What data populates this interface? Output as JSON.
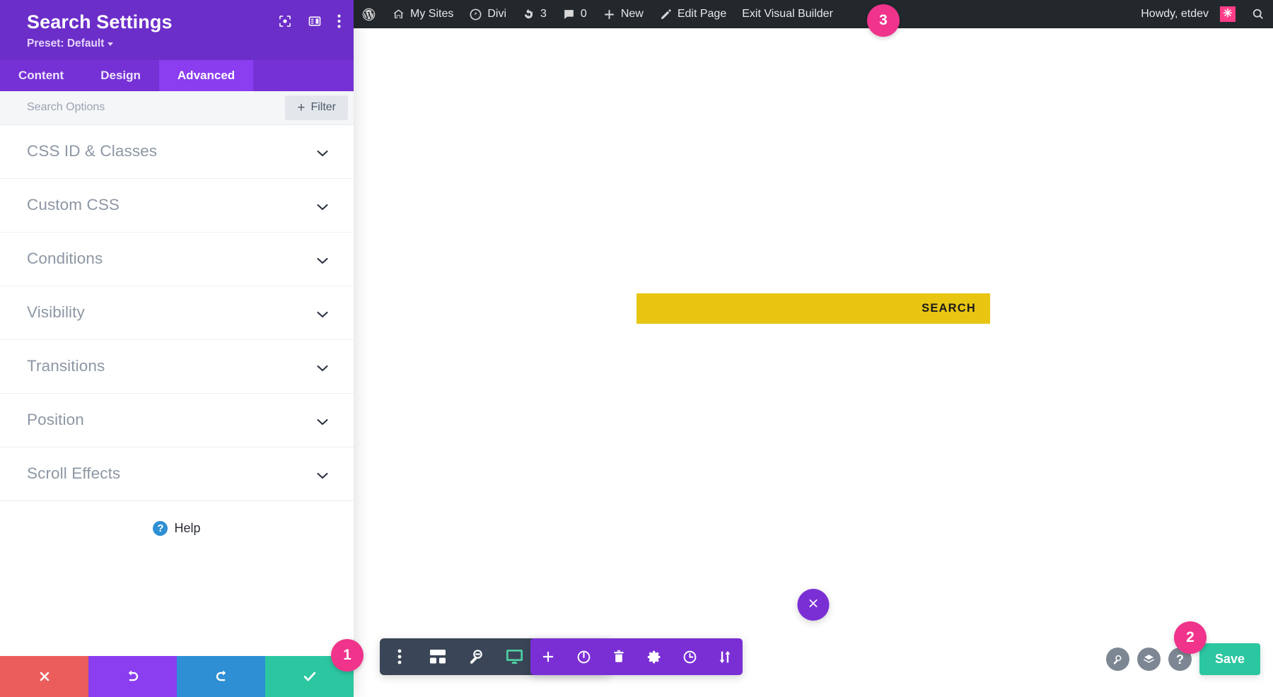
{
  "admin_bar": {
    "items": [
      {
        "icon": "wordpress-logo-icon",
        "label": ""
      },
      {
        "icon": "my-sites-icon",
        "label": "My Sites"
      },
      {
        "icon": "divi-icon",
        "label": "Divi"
      },
      {
        "icon": "updates-icon",
        "label": "3"
      },
      {
        "icon": "comments-icon",
        "label": "0"
      },
      {
        "icon": "plus-icon",
        "label": "New"
      },
      {
        "icon": "pencil-icon",
        "label": "Edit Page"
      },
      {
        "icon": "",
        "label": "Exit Visual Builder"
      }
    ],
    "howdy": "Howdy, etdev",
    "avatar_glyph": "✳",
    "search_icon": "search-icon",
    "bg_color": "#23282d"
  },
  "panel": {
    "title": "Search Settings",
    "preset_label": "Preset: Default",
    "header_icons": [
      "focus-frame-icon",
      "layout-columns-icon",
      "kebab-menu-icon"
    ],
    "accent_color": "#6b2ec9",
    "tabs": [
      {
        "label": "Content",
        "active": false
      },
      {
        "label": "Design",
        "active": false
      },
      {
        "label": "Advanced",
        "active": true
      }
    ],
    "options_row": {
      "label": "Search Options",
      "filter_label": "Filter",
      "filter_plus": "+"
    },
    "sections": [
      {
        "label": "CSS ID & Classes"
      },
      {
        "label": "Custom CSS"
      },
      {
        "label": "Conditions"
      },
      {
        "label": "Visibility"
      },
      {
        "label": "Transitions"
      },
      {
        "label": "Position"
      },
      {
        "label": "Scroll Effects"
      }
    ],
    "help": {
      "label": "Help",
      "glyph": "?"
    },
    "actions": [
      {
        "name": "discard-button",
        "icon": "close-x-icon",
        "color": "#eb5d5d"
      },
      {
        "name": "undo-button",
        "icon": "undo-arrow-icon",
        "color": "#8b3df0"
      },
      {
        "name": "redo-button",
        "icon": "redo-arrow-icon",
        "color": "#2e8fd4"
      },
      {
        "name": "save-check-button",
        "icon": "checkmark-icon",
        "color": "#2cc6a0"
      }
    ]
  },
  "canvas": {
    "search_module": {
      "button_label": "SEARCH",
      "bar_color": "#e8c511",
      "input_value": "",
      "input_placeholder": ""
    },
    "close_button_icon": "close-x-icon"
  },
  "view_bar": {
    "icons": [
      {
        "name": "kebab-menu-icon",
        "active": false
      },
      {
        "name": "wireframe-view-icon",
        "active": false
      },
      {
        "name": "zoom-out-view-icon",
        "active": false
      },
      {
        "name": "desktop-view-icon",
        "active": true
      },
      {
        "name": "tablet-view-icon",
        "active": false
      },
      {
        "name": "phone-view-icon",
        "active": false
      }
    ],
    "active_color": "#4fd1a5",
    "bg_color": "#3a4657"
  },
  "module_bar": {
    "bg_color": "#7a2fd4",
    "icons": [
      {
        "name": "add-module-icon"
      },
      {
        "name": "power-toggle-icon"
      },
      {
        "name": "delete-trash-icon"
      },
      {
        "name": "module-settings-gear-icon"
      },
      {
        "name": "history-clock-icon"
      },
      {
        "name": "sort-arrows-icon"
      }
    ]
  },
  "right_tools": {
    "circles": [
      {
        "name": "search-tool-icon",
        "glyph": ""
      },
      {
        "name": "layers-tool-icon",
        "glyph": ""
      },
      {
        "name": "help-tool-icon",
        "glyph": "?"
      }
    ],
    "save_label": "Save",
    "save_color": "#2cc6a0"
  },
  "badges": [
    {
      "id": "badge1",
      "label": "1"
    },
    {
      "id": "badge2",
      "label": "2"
    },
    {
      "id": "badge3",
      "label": "3"
    }
  ],
  "badge_color": "#f0338b"
}
